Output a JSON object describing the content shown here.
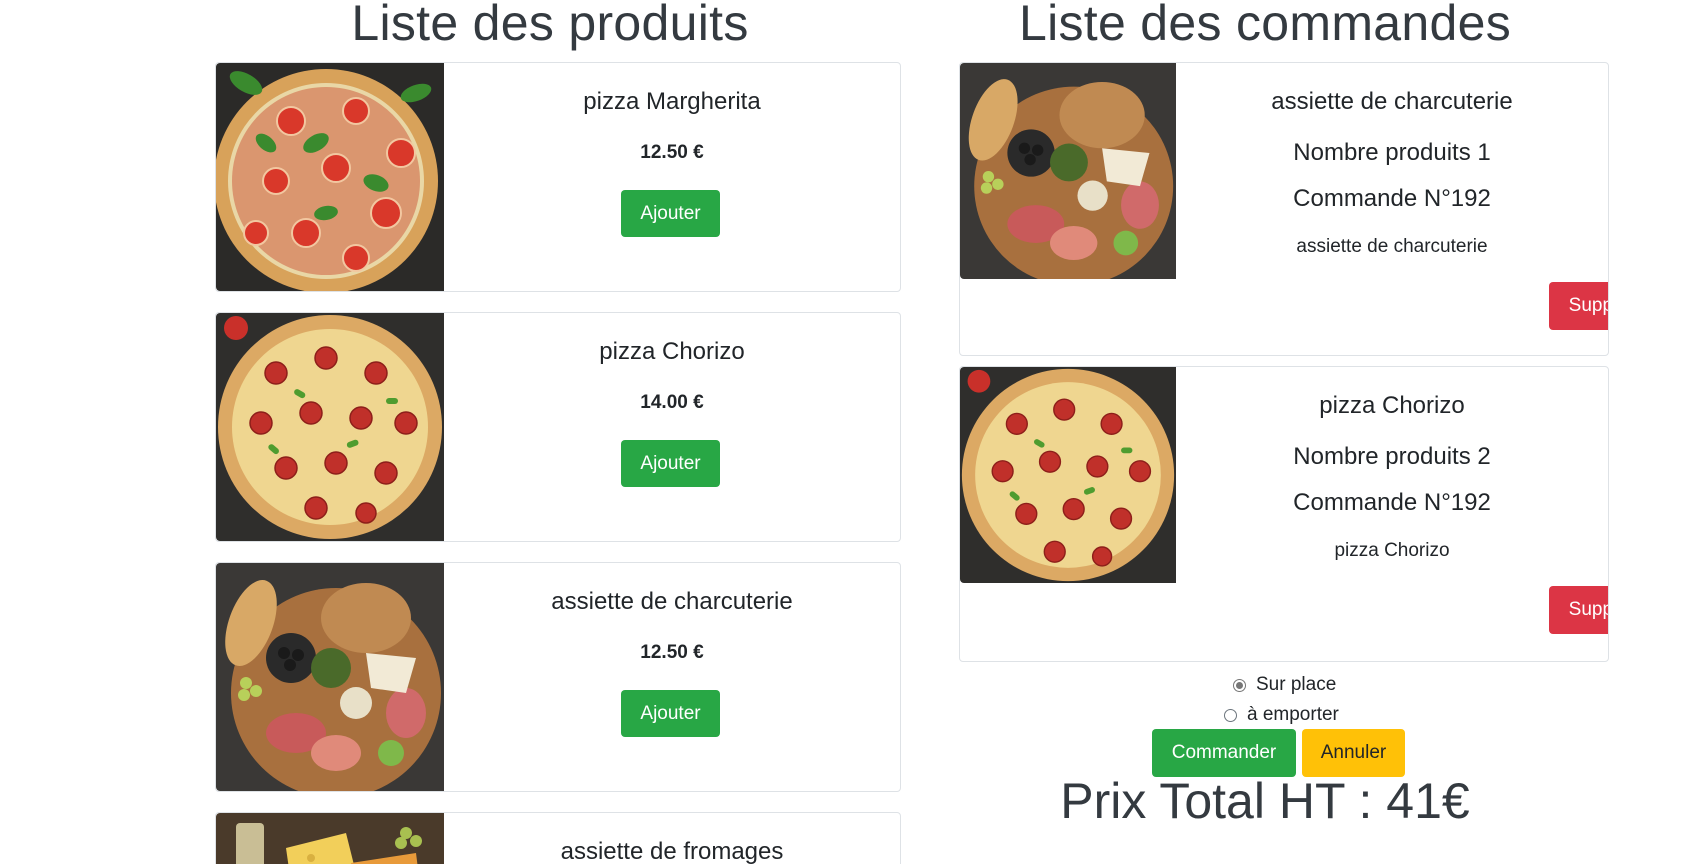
{
  "products": {
    "title": "Liste des produits",
    "items": [
      {
        "name": "pizza Margherita",
        "price": "12.50 €",
        "add_label": "Ajouter",
        "image": "pizza-margherita"
      },
      {
        "name": "pizza Chorizo",
        "price": "14.00 €",
        "add_label": "Ajouter",
        "image": "pizza-chorizo"
      },
      {
        "name": "assiette de charcuterie",
        "price": "12.50 €",
        "add_label": "Ajouter",
        "image": "charcuterie-board"
      },
      {
        "name": "assiette de fromages",
        "image": "cheese-board"
      }
    ]
  },
  "orders": {
    "title": "Liste des commandes",
    "items": [
      {
        "name": "assiette de charcuterie",
        "count": "Nombre produits 1",
        "order_no": "Commande N°192",
        "description": "assiette de charcuterie",
        "delete_label": "Supprimer",
        "image": "charcuterie-board"
      },
      {
        "name": "pizza Chorizo",
        "count": "Nombre produits 2",
        "order_no": "Commande N°192",
        "description": "pizza Chorizo",
        "delete_label": "Supprimer",
        "image": "pizza-chorizo"
      }
    ],
    "options": [
      {
        "label": "Sur place",
        "checked": true
      },
      {
        "label": "à emporter",
        "checked": false
      }
    ],
    "order_label": "Commander",
    "cancel_label": "Annuler",
    "total": "Prix Total HT : 41€"
  },
  "colors": {
    "success": "#28a745",
    "danger": "#dc3545",
    "warning": "#ffc107",
    "heading": "#343a40"
  }
}
